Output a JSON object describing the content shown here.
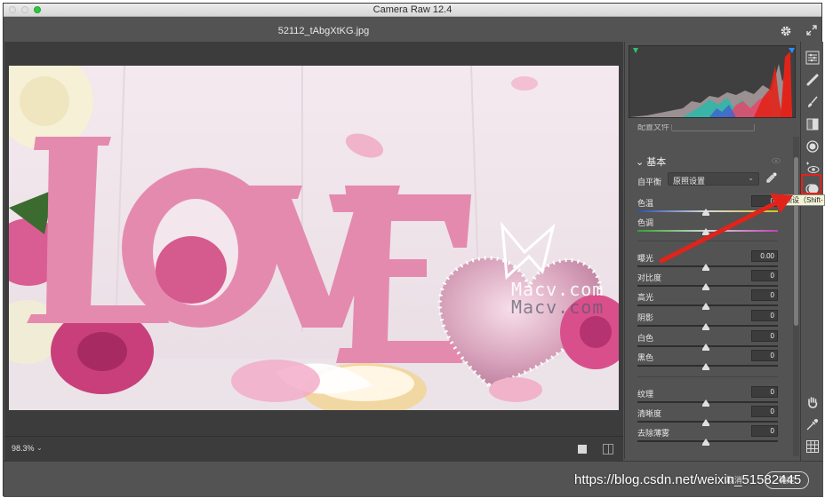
{
  "window": {
    "title": "Camera Raw 12.4"
  },
  "header": {
    "file_name": "52112_tAbgXtKG.jpg",
    "settings_icon": "gear-icon",
    "fullscreen_icon": "expand-icon"
  },
  "canvas": {
    "photo_description_icon": "photo",
    "watermark_text": "Macv.com",
    "zoom": "98.3%"
  },
  "panel": {
    "sub_label": "配置文件",
    "section_title": "基本",
    "white_balance": {
      "label": "自平衡",
      "value": "原照设置"
    },
    "sliders": [
      {
        "label": "色温",
        "value": "0"
      },
      {
        "label": "色调",
        "value": ""
      },
      {
        "label": "曝光",
        "value": "0.00"
      },
      {
        "label": "对比度",
        "value": "0"
      },
      {
        "label": "高光",
        "value": "0"
      },
      {
        "label": "阴影",
        "value": "0"
      },
      {
        "label": "白色",
        "value": "0"
      },
      {
        "label": "黑色",
        "value": "0"
      },
      {
        "label": "纹理",
        "value": "0"
      },
      {
        "label": "清晰度",
        "value": "0"
      },
      {
        "label": "去除薄雾",
        "value": "0"
      }
    ]
  },
  "toolbar": {
    "tooltip": "预设（Shift-",
    "tools": [
      "edit-sliders-icon",
      "healing-icon",
      "brush-icon",
      "gradient-icon",
      "radial-icon",
      "redeye-icon",
      "presets-icon",
      "hand-icon",
      "color-sampler-icon",
      "grid-icon"
    ]
  },
  "footer": {
    "cancel_label": "取消",
    "ok_label": "确定",
    "overlay_url": "https://blog.csdn.net/weixin_51582445"
  },
  "colors": {
    "accent_red": "#e2231a",
    "panel_bg": "#535353",
    "canvas_bg": "#3c3c3c"
  }
}
